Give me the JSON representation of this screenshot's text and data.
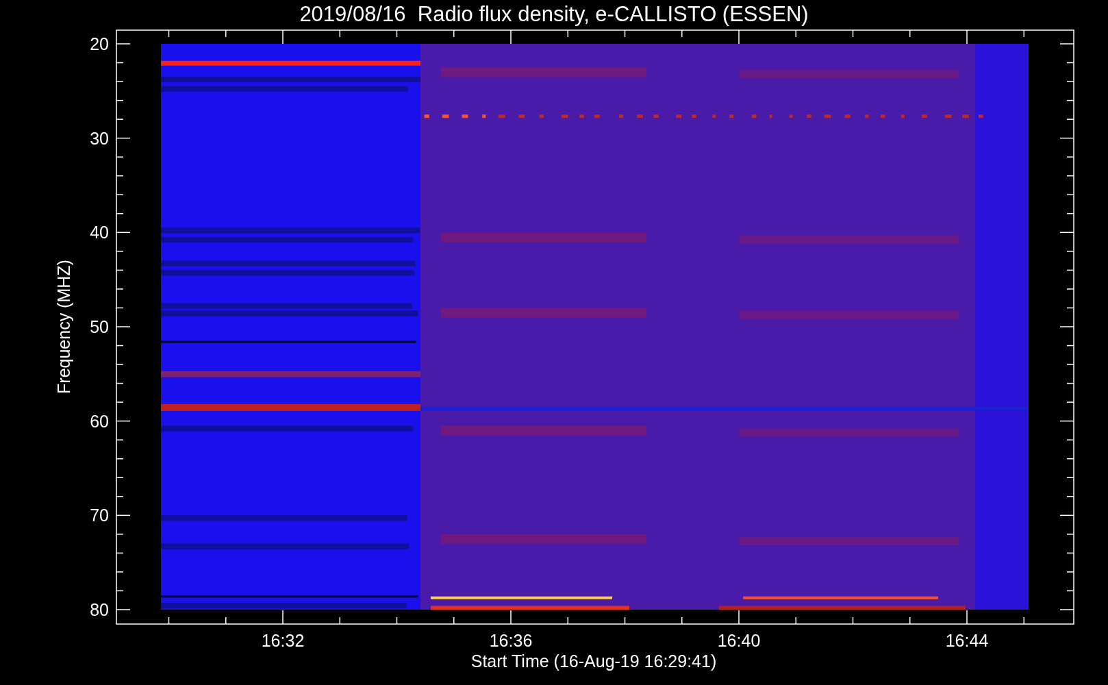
{
  "title": "2019/08/16  Radio flux density, e-CALLISTO (ESSEN)",
  "y_axis": {
    "label": "Frequency (MHZ)",
    "ticks": [
      "20",
      "30",
      "40",
      "50",
      "60",
      "70",
      "80"
    ]
  },
  "x_axis": {
    "label": "Start Time (16-Aug-19 16:29:41)",
    "ticks": [
      "16:32",
      "16:36",
      "16:40",
      "16:44"
    ]
  }
}
